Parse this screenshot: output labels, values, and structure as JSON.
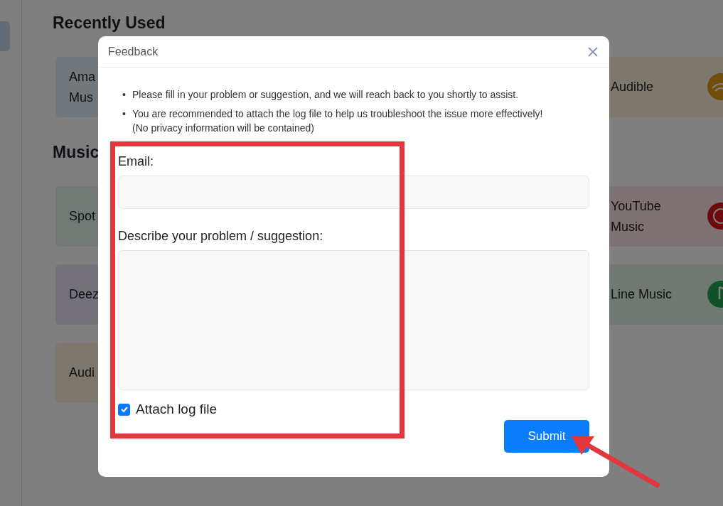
{
  "background": {
    "sections": [
      {
        "heading": "Recently Used",
        "rows": [
          {
            "left": {
              "label": "Ama\nMus"
            },
            "right": {
              "label": "Audible",
              "kind": "wave"
            }
          }
        ]
      },
      {
        "heading": "Music",
        "rows": [
          {
            "left": {
              "label": "Spot"
            },
            "right": {
              "label": "YouTube\nMusic",
              "kind": "play"
            }
          },
          {
            "left": {
              "label": "Deez"
            },
            "right": {
              "label": "Line Music",
              "kind": "note"
            }
          },
          {
            "left": {
              "label": "Audi"
            }
          }
        ]
      }
    ]
  },
  "dialog": {
    "title": "Feedback",
    "notes": [
      {
        "bullet": "•",
        "text": "Please fill in your problem or suggestion, and we will reach back to you shortly to assist."
      },
      {
        "bullet": "•",
        "text": "You are recommended to attach the log file to help us troubleshoot the issue more effectively!\n(No privacy information will be contained)"
      }
    ],
    "email": {
      "label": "Email:"
    },
    "description": {
      "label": "Describe your problem / suggestion:"
    },
    "attach_log": {
      "label": "Attach log file",
      "checked": true
    },
    "submit": "Submit"
  }
}
